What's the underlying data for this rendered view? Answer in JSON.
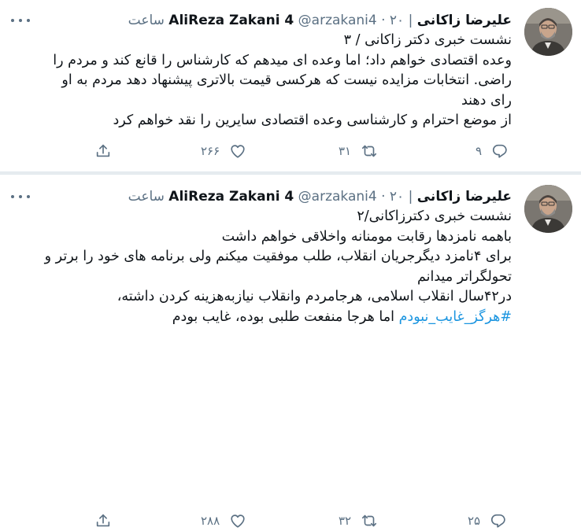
{
  "tweets": [
    {
      "display_name": "علیرضا زاکانی",
      "name_en": "AliReza Zakani 4",
      "handle": "@arzakani4",
      "time": "۲۰ ساعت",
      "lines": [
        "نشست خبری دکتر زاکانی / ۳",
        "وعده اقتصادی خواهم داد؛ اما وعده ای میدهم که کارشناس را قانع کند و مردم را",
        "راضی. انتخابات مزایده نیست که هرکسی قیمت بالاتری پیشنهاد دهد مردم به او",
        "رای دهند",
        "از موضع احترام و کارشناسی وعده اقتصادی سایرین را نقد خواهم کرد"
      ],
      "replies": "۹",
      "retweets": "۳۱",
      "likes": "۲۶۶"
    },
    {
      "display_name": "علیرضا زاکانی",
      "name_en": "AliReza Zakani 4",
      "handle": "@arzakani4",
      "time": "۲۰ ساعت",
      "lines": [
        "نشست خبری دکترزاکانی/۲",
        "باهمه نامزدها رقابت مومنانه واخلاقی خواهم داشت",
        "برای ۴نامزد دیگرجریان انقلاب، طلب موفقیت میکنم ولی برنامه های خود را برتر و",
        "تحولگراتر میدانم",
        "در۴۲سال انقلاب اسلامی، هرجامردم وانقلاب نیازبه‌هزینه کردن داشته،"
      ],
      "last_line_tail": "اما هرجا منفعت طلبی بوده، غایب بودم",
      "hashtag": "#هرگز_غایب_نبودم",
      "replies": "۲۵",
      "retweets": "۳۲",
      "likes": "۲۸۸"
    }
  ],
  "icons": {
    "more": "more-horizontal-icon",
    "reply": "reply-icon",
    "retweet": "retweet-icon",
    "like": "heart-icon",
    "share": "share-icon"
  },
  "colors": {
    "text": "#0f1419",
    "secondary": "#5b7083",
    "hashtag": "#1b95e0",
    "separator": "#e7ecf0"
  }
}
